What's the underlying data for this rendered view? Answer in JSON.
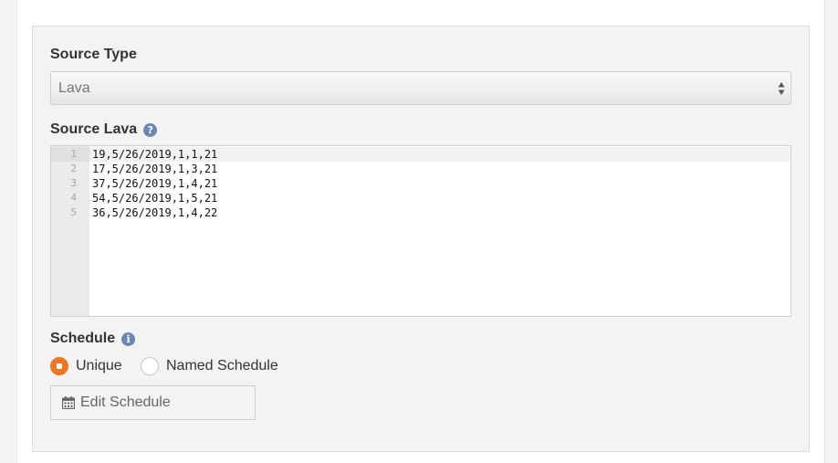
{
  "source_type": {
    "label": "Source Type",
    "selected": "Lava"
  },
  "source_lava": {
    "label": "Source Lava",
    "help_icon": "?",
    "lines": [
      {
        "num": "1",
        "text": "19,5/26/2019,1,1,21"
      },
      {
        "num": "2",
        "text": "17,5/26/2019,1,3,21"
      },
      {
        "num": "3",
        "text": "37,5/26/2019,1,4,21"
      },
      {
        "num": "4",
        "text": "54,5/26/2019,1,5,21"
      },
      {
        "num": "5",
        "text": "36,5/26/2019,1,4,22"
      }
    ]
  },
  "schedule": {
    "label": "Schedule",
    "info_icon": "i",
    "options": [
      {
        "label": "Unique",
        "checked": true
      },
      {
        "label": "Named Schedule",
        "checked": false
      }
    ],
    "edit_button_label": "Edit Schedule"
  },
  "colors": {
    "accent_orange": "#ee7625",
    "help_blue": "#6d86b3"
  }
}
